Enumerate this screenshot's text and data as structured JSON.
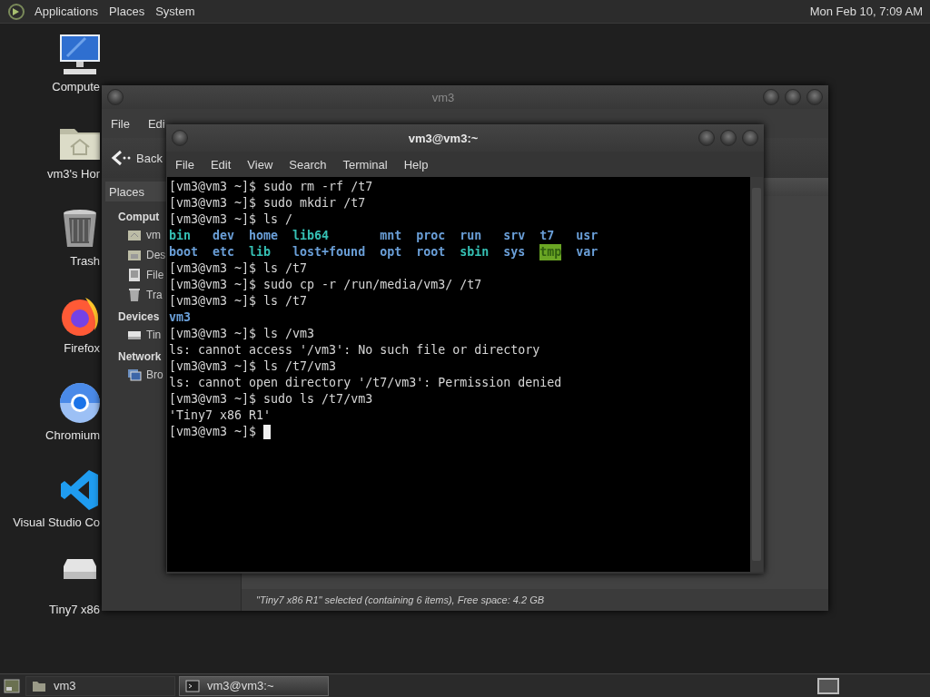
{
  "top_panel": {
    "menus": [
      "Applications",
      "Places",
      "System"
    ],
    "clock": "Mon Feb 10, 7:09 AM"
  },
  "desktop_icons": [
    {
      "label": "Compute",
      "kind": "monitor"
    },
    {
      "label": "vm3's Hor",
      "kind": "home"
    },
    {
      "label": "Trash",
      "kind": "trash"
    },
    {
      "label": "Firefox",
      "kind": "fox"
    },
    {
      "label": "Chromium",
      "kind": "globe"
    },
    {
      "label": "Visual Studio Co",
      "kind": "code"
    },
    {
      "label": "Tiny7 x86",
      "kind": "drive"
    }
  ],
  "file_manager": {
    "title": "vm3",
    "menus": [
      "File",
      "Edi"
    ],
    "back": "Back",
    "sidebar": {
      "header": "Places",
      "sections": [
        {
          "title": "Comput",
          "items": [
            {
              "label": "vm",
              "kind": "home"
            },
            {
              "label": "Des",
              "kind": "desktop"
            },
            {
              "label": "File",
              "kind": "disk"
            },
            {
              "label": "Tra",
              "kind": "trash"
            }
          ]
        },
        {
          "title": "Devices",
          "items": [
            {
              "label": "Tin",
              "kind": "drive"
            }
          ]
        },
        {
          "title": "Network",
          "items": [
            {
              "label": "Bro",
              "kind": "network"
            }
          ]
        }
      ]
    },
    "status": "\"Tiny7 x86 R1\" selected (containing 6 items), Free space: 4.2 GB"
  },
  "terminal": {
    "title": "vm3@vm3:~",
    "menus": [
      "File",
      "Edit",
      "View",
      "Search",
      "Terminal",
      "Help"
    ],
    "lines": [
      {
        "kind": "text",
        "text": "[vm3@vm3 ~]$ sudo rm -rf /t7"
      },
      {
        "kind": "text",
        "text": "[vm3@vm3 ~]$ sudo mkdir /t7"
      },
      {
        "kind": "text",
        "text": "[vm3@vm3 ~]$ ls /"
      },
      {
        "kind": "listing",
        "rows": [
          [
            {
              "text": "bin",
              "color": "#35c0b4"
            },
            {
              "text": "dev",
              "color": "#6a9fd8"
            },
            {
              "text": "home",
              "color": "#6a9fd8"
            },
            {
              "text": "lib64",
              "color": "#35c0b4"
            },
            {
              "text": "mnt",
              "color": "#6a9fd8"
            },
            {
              "text": "proc",
              "color": "#6a9fd8"
            },
            {
              "text": "run",
              "color": "#6a9fd8"
            },
            {
              "text": "srv",
              "color": "#6a9fd8"
            },
            {
              "text": "t7",
              "color": "#6a9fd8"
            },
            {
              "text": "usr",
              "color": "#6a9fd8"
            }
          ],
          [
            {
              "text": "boot",
              "color": "#6a9fd8"
            },
            {
              "text": "etc",
              "color": "#6a9fd8"
            },
            {
              "text": "lib",
              "color": "#35c0b4"
            },
            {
              "text": "lost+found",
              "color": "#6a9fd8"
            },
            {
              "text": "opt",
              "color": "#6a9fd8"
            },
            {
              "text": "root",
              "color": "#6a9fd8"
            },
            {
              "text": "sbin",
              "color": "#35c0b4"
            },
            {
              "text": "sys",
              "color": "#6a9fd8"
            },
            {
              "text": "tmp",
              "color": "#6aa524",
              "highlighted": true
            },
            {
              "text": "var",
              "color": "#6a9fd8"
            }
          ]
        ]
      },
      {
        "kind": "text",
        "text": "[vm3@vm3 ~]$ ls /t7"
      },
      {
        "kind": "text",
        "text": "[vm3@vm3 ~]$ sudo cp -r /run/media/vm3/ /t7"
      },
      {
        "kind": "text",
        "text": "[vm3@vm3 ~]$ ls /t7"
      },
      {
        "kind": "listing",
        "rows": [
          [
            {
              "text": "vm3",
              "color": "#6a9fd8"
            }
          ]
        ]
      },
      {
        "kind": "text",
        "text": "[vm3@vm3 ~]$ ls /vm3"
      },
      {
        "kind": "text",
        "text": "ls: cannot access '/vm3': No such file or directory"
      },
      {
        "kind": "text",
        "text": "[vm3@vm3 ~]$ ls /t7/vm3"
      },
      {
        "kind": "text",
        "text": "ls: cannot open directory '/t7/vm3': Permission denied"
      },
      {
        "kind": "text",
        "text": "[vm3@vm3 ~]$ sudo ls /t7/vm3"
      },
      {
        "kind": "text",
        "text": "'Tiny7 x86 R1'"
      },
      {
        "kind": "text",
        "text": "[vm3@vm3 ~]$",
        "cursor": true
      }
    ]
  },
  "taskbar": {
    "tasks": [
      {
        "label": "vm3",
        "kind": "folder",
        "selected": false
      },
      {
        "label": "vm3@vm3:~",
        "kind": "terminal",
        "selected": true
      }
    ]
  }
}
